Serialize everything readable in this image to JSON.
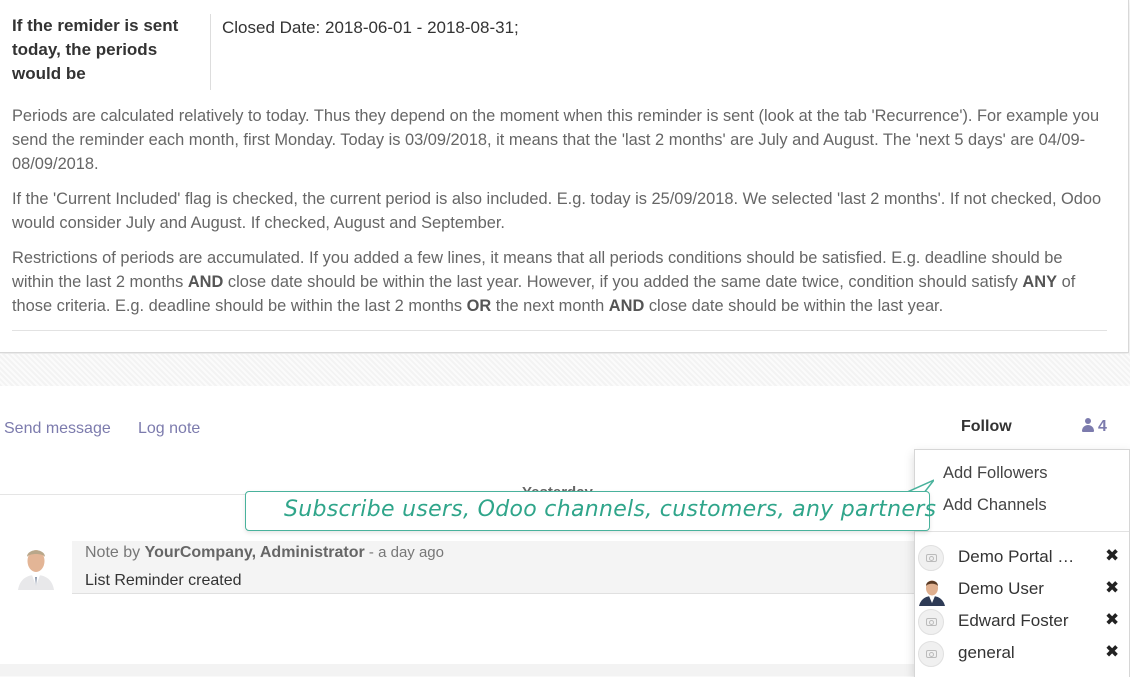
{
  "period": {
    "label": "If the remider is sent today, the periods would be",
    "value": "Closed Date: 2018-06-01 - 2018-08-31;"
  },
  "help": {
    "p1": "Periods are calculated relatively to today. Thus they depend on the moment when this reminder is sent (look at the tab 'Recurrence'). For example you send the reminder each month, first Monday. Today is 03/09/2018, it means that the 'last 2 months' are July and August. The 'next 5 days' are 04/09-08/09/2018.",
    "p2": "If the 'Current Included' flag is checked, the current period is also included. E.g. today is 25/09/2018. We selected 'last 2 months'. If not checked, Odoo would consider July and August. If checked, August and September.",
    "p3": {
      "t1": "Restrictions of periods are accumulated. If you added a few lines, it means that all periods conditions should be satisfied. E.g. deadline should be within the last 2 months ",
      "b1": "AND",
      "t2": " close date should be within the last year. However, if you added the same date twice, condition should satisfy ",
      "b2": "ANY",
      "t3": " of those criteria. E.g. deadline should be within the last 2 months ",
      "b3": "OR",
      "t4": " the next month ",
      "b4": "AND",
      "t5": " close date should be within the last year."
    }
  },
  "chatter": {
    "send_message": "Send message",
    "log_note": "Log note",
    "follow": "Follow",
    "followers_count": "4",
    "day_label": "Yesterday"
  },
  "message": {
    "prefix": "Note by ",
    "author": "YourCompany, Administrator",
    "time": " - a day ago",
    "body": "List Reminder created"
  },
  "dropdown": {
    "add_followers": "Add Followers",
    "add_channels": "Add Channels",
    "followers": [
      {
        "name": "Demo Portal User",
        "avatar": "placeholder"
      },
      {
        "name": "Demo User",
        "avatar": "photo"
      },
      {
        "name": "Edward Foster",
        "avatar": "placeholder"
      },
      {
        "name": "general",
        "avatar": "placeholder"
      }
    ],
    "remove_glyph": "✖"
  },
  "callout": {
    "text": "Subscribe users, Odoo channels, customers, any partners",
    "color": "#2fa58a"
  },
  "colors": {
    "link": "#7c7bad",
    "callout_border": "#49b29c"
  }
}
